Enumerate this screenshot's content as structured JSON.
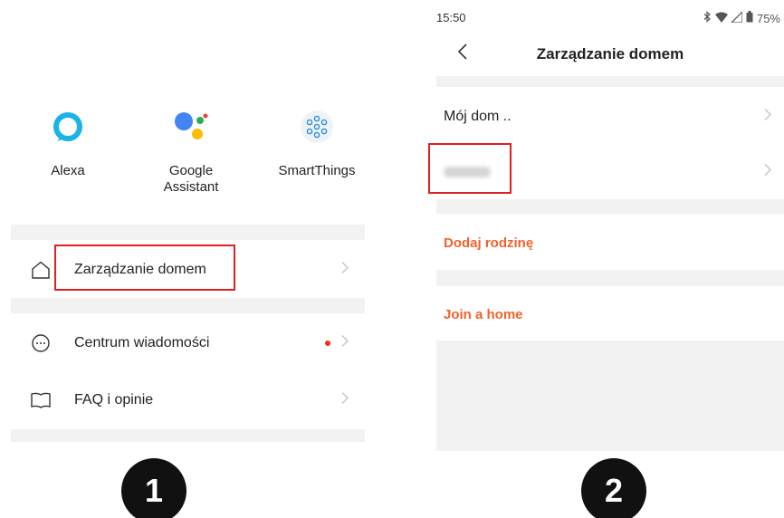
{
  "left": {
    "integrations": [
      {
        "name": "Alexa",
        "icon": "alexa-icon"
      },
      {
        "name_line1": "Google",
        "name_line2": "Assistant",
        "icon": "google-assistant-icon"
      },
      {
        "name": "SmartThings",
        "icon": "smartthings-icon"
      }
    ],
    "menu": [
      {
        "label": "Zarządzanie domem",
        "icon": "home-icon",
        "has_dot": false
      },
      {
        "label": "Centrum wiadomości",
        "icon": "chat-bubble-icon",
        "has_dot": true
      },
      {
        "label": "FAQ i opinie",
        "icon": "book-icon",
        "has_dot": false
      }
    ],
    "step": "1"
  },
  "right": {
    "status_time": "15:50",
    "battery": "75%",
    "title": "Zarządzanie domem",
    "homes": [
      {
        "label": "Mój dom .."
      },
      {
        "label": "",
        "blurred": true
      }
    ],
    "add_family": "Dodaj rodzinę",
    "join_home": "Join a home",
    "step": "2"
  },
  "colors": {
    "accent_orange": "#f2622c",
    "highlight_red": "#e02020",
    "separator_gray": "#f2f2f2"
  }
}
